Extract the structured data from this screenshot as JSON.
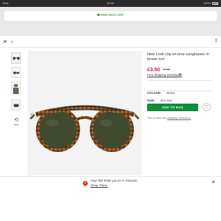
{
  "status_bar": {
    "device": "iPad",
    "wifi": "wifi-icon",
    "time": "00:50",
    "battery_percent": "100%"
  },
  "browser": {
    "url": "www.asos.com",
    "close_icon": "close-icon",
    "back_icon": "chevron-left-icon",
    "share_icon": "share-icon"
  },
  "thumbnails": [
    {
      "label": "glasses-front",
      "active": true
    },
    {
      "label": "glasses-side",
      "active": false
    },
    {
      "label": "model-wearing",
      "active": false
    },
    {
      "label": "glasses-folded",
      "active": false
    }
  ],
  "view360_label": "360",
  "product": {
    "title": "New Look clip on lens sunglasses in brown tort",
    "price": "£3.50",
    "old_price": "£7.99",
    "shipping_link": "Free Shipping Worldwide*",
    "colour_label": "COLOUR:",
    "colour_value": "Brown",
    "size_label": "SIZE:",
    "size_value": "One Size",
    "add_to_bag": "ADD TO BAG",
    "restriction_text": "This product has ",
    "restriction_link": "shipping restrictions."
  },
  "banner": {
    "message": "Hey! We think you're in Vietnam",
    "link": "Shop There"
  },
  "colors": {
    "accent_green": "#138a3d",
    "price_red": "#d01345",
    "url_green": "#2f8c35"
  }
}
